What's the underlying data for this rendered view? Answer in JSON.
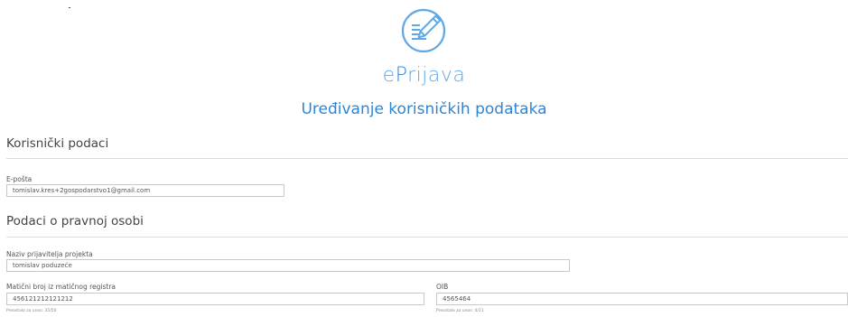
{
  "app": {
    "brand_prefix": "e",
    "brand_accent": "P",
    "brand_suffix": "rijava",
    "subtitle": "Uređivanje korisničkih podataka",
    "colors": {
      "brand": "#62a8e5",
      "accent": "#2c86d8"
    },
    "icon": "document-edit-icon"
  },
  "user_section": {
    "title": "Korisnički podaci",
    "email_label": "E-pošta",
    "email_value": "tomislav.kres+2gospodarstvo1@gmail.com"
  },
  "legal_section": {
    "title": "Podaci o pravnoj osobi",
    "applicant_label": "Naziv prijavitelja projekta",
    "applicant_value": "tomislav poduzeće",
    "registry_label": "Matični broj iz matičnog registra",
    "registry_value": "456121212121212",
    "registry_hint": "Preostalo za unos: 35/50",
    "oib_label": "OIB",
    "oib_value": "4565464",
    "oib_hint": "Preostalo za unos: 4/11"
  }
}
